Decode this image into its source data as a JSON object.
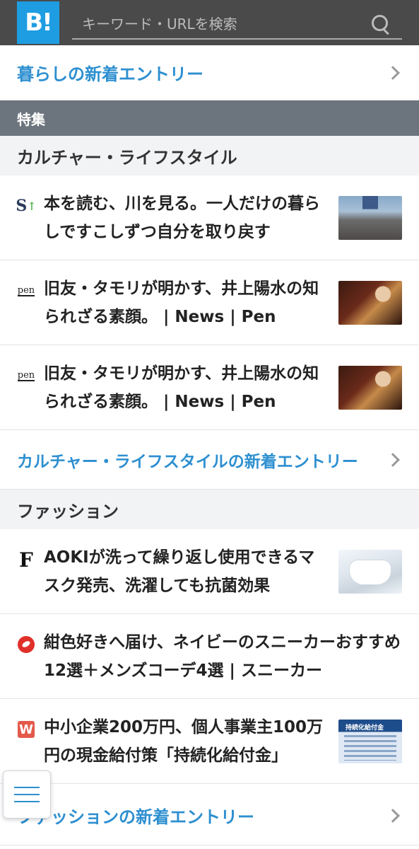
{
  "header": {
    "logo_text": "B!",
    "search_placeholder": "キーワード・URLを検索"
  },
  "top_link": {
    "label": "暮らしの新着エントリー"
  },
  "section": {
    "title": "特集"
  },
  "categories": [
    {
      "title": "カルチャー・ライフスタイル",
      "entries": [
        {
          "favicon": "s-arrow-icon",
          "title": "本を読む、川を見る。一人だけの暮らしですこしずつ自分を取り戻す"
        },
        {
          "favicon": "pen-icon",
          "favicon_text": "pen",
          "title": "旧友・タモリが明かす、井上陽水の知られざる素顔。 | News | Pen"
        },
        {
          "favicon": "pen-icon",
          "favicon_text": "pen",
          "title": "旧友・タモリが明かす、井上陽水の知られざる素顔。 | News | Pen"
        }
      ],
      "more_label": "カルチャー・ライフスタイルの新着エントリー"
    },
    {
      "title": "ファッション",
      "entries": [
        {
          "favicon": "f-icon",
          "favicon_text": "F",
          "title": "AOKIが洗って繰り返し使用できるマスク発売、洗濯しても抗菌効果"
        },
        {
          "favicon": "red-badge-icon",
          "title": "紺色好きへ届け、ネイビーのスニーカーおすすめ12選＋メンズコーデ4選 | スニーカー"
        },
        {
          "favicon": "w-icon",
          "favicon_text": "W",
          "title": "中小企業200万円、個人事業主100万円の現金給付策「持続化給付金」"
        }
      ],
      "more_label": "ファッションの新着エントリー"
    }
  ],
  "thumbnail_text": {
    "subsidy": "持続化給付金"
  },
  "colors": {
    "accent": "#2d8fd0",
    "header_bg": "#4a4a4a",
    "logo_bg": "#1e9de2",
    "section_bg": "#6c757d"
  }
}
